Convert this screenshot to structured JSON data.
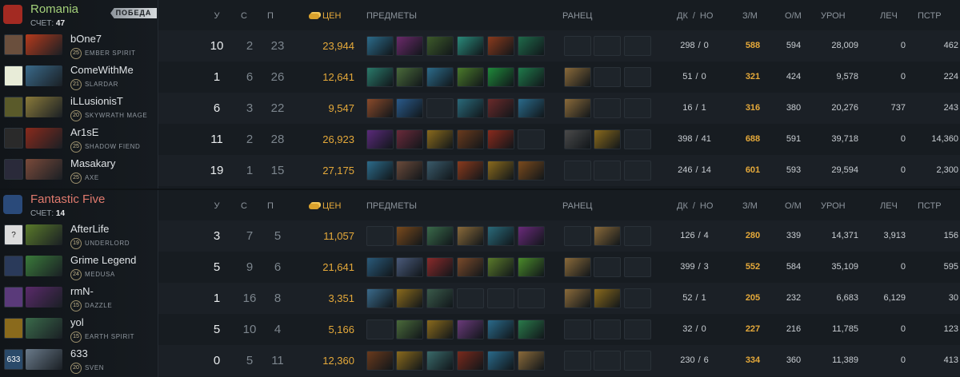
{
  "headers": {
    "kills": "У",
    "deaths": "С",
    "assists": "П",
    "networth": "ЦЕН",
    "items": "ПРЕДМЕТЫ",
    "backpack": "РАНЕЦ",
    "lasthits": "ДК",
    "slash": "/",
    "denies": "НО",
    "gpm": "З/М",
    "xpm": "О/М",
    "damage": "УРОН",
    "heal": "ЛЕЧ",
    "building": "ПСТР"
  },
  "teams": [
    {
      "name": "Romania",
      "name_color": "#a4d17a",
      "score_label": "СЧЕТ:",
      "score": "47",
      "badge": "ПОБЕДА",
      "logo_color": "#a32a22",
      "players": [
        {
          "name": "bOne7",
          "level": "25",
          "hero": "EMBER SPIRIT",
          "avatar_color": "#6a4f3d",
          "avatar_text": "",
          "hero_color": "#b53a1c",
          "kills": "10",
          "deaths": "2",
          "assists": "23",
          "networth": "23,944",
          "items": [
            "#2c6b8a",
            "#6b2a6a",
            "#3d5a2a",
            "#2a8a7a",
            "#8a3a1c",
            "#1f6a4a"
          ],
          "backpack": [
            "",
            "",
            ""
          ],
          "lh": "298",
          "dn": "0",
          "gpm": "588",
          "xpm": "594",
          "damage": "28,009",
          "heal": "0",
          "building": "462"
        },
        {
          "name": "ComeWithMe",
          "level": "21",
          "hero": "SLARDAR",
          "avatar_color": "#e8ecd8",
          "avatar_text": "",
          "hero_color": "#3a6a8a",
          "kills": "1",
          "deaths": "6",
          "assists": "26",
          "networth": "12,641",
          "items": [
            "#2a7a6a",
            "#4a6a3a",
            "#2c6b8a",
            "#4a7a2a",
            "#1f8a3a",
            "#1f7a4a"
          ],
          "backpack": [
            "#8a6a3a",
            "",
            ""
          ],
          "lh": "51",
          "dn": "0",
          "gpm": "321",
          "xpm": "424",
          "damage": "9,578",
          "heal": "0",
          "building": "224"
        },
        {
          "name": "iLLusionisT",
          "level": "20",
          "hero": "SKYWRATH MAGE",
          "avatar_color": "#5a5a2a",
          "avatar_text": "",
          "hero_color": "#8a7a3a",
          "kills": "6",
          "deaths": "3",
          "assists": "22",
          "networth": "9,547",
          "items": [
            "#8a4a2a",
            "#2a5a8a",
            "",
            "#2a6a7a",
            "#6a2a2a",
            "#2a6a8a"
          ],
          "backpack": [
            "#8a6a3a",
            "",
            ""
          ],
          "lh": "16",
          "dn": "1",
          "gpm": "316",
          "xpm": "380",
          "damage": "20,276",
          "heal": "737",
          "building": "243"
        },
        {
          "name": "Ar1sE",
          "level": "25",
          "hero": "SHADOW FIEND",
          "avatar_color": "#2a2a2a",
          "avatar_text": "",
          "hero_color": "#8a2a1c",
          "kills": "11",
          "deaths": "2",
          "assists": "28",
          "networth": "26,923",
          "items": [
            "#5a2a7a",
            "#6a2a3a",
            "#8a6a1c",
            "#6a3a1c",
            "#8a2a1c",
            ""
          ],
          "backpack": [
            "#4a4a4a",
            "#8a6a1c",
            ""
          ],
          "lh": "398",
          "dn": "41",
          "gpm": "688",
          "xpm": "591",
          "damage": "39,718",
          "heal": "0",
          "building": "14,360"
        },
        {
          "name": "Masakary",
          "level": "25",
          "hero": "AXE",
          "avatar_color": "#2a2a3a",
          "avatar_text": "",
          "hero_color": "#7a4a3a",
          "kills": "19",
          "deaths": "1",
          "assists": "15",
          "networth": "27,175",
          "items": [
            "#2c6b8a",
            "#6a4a3a",
            "#3a5a6a",
            "#8a3a1c",
            "#8a6a1c",
            "#7a4a1c"
          ],
          "backpack": [
            "",
            "",
            ""
          ],
          "lh": "246",
          "dn": "14",
          "gpm": "601",
          "xpm": "593",
          "damage": "29,594",
          "heal": "0",
          "building": "2,300"
        }
      ]
    },
    {
      "name": "Fantastic Five",
      "name_color": "#e07a6e",
      "score_label": "СЧЕТ:",
      "score": "14",
      "badge": "",
      "logo_color": "#2a4a7a",
      "players": [
        {
          "name": "AfterLife",
          "level": "19",
          "hero": "UNDERLORD",
          "avatar_color": "#dcdcdc",
          "avatar_text": "?",
          "hero_color": "#5a7a2a",
          "kills": "3",
          "deaths": "7",
          "assists": "5",
          "networth": "11,057",
          "items": [
            "",
            "#7a4a1c",
            "#3a6a4a",
            "#8a6a3a",
            "#2a6a7a",
            "#6a2a7a"
          ],
          "backpack": [
            "",
            "#8a6a3a",
            ""
          ],
          "lh": "126",
          "dn": "4",
          "gpm": "280",
          "xpm": "339",
          "damage": "14,371",
          "heal": "3,913",
          "building": "156"
        },
        {
          "name": "Grime Legend",
          "level": "24",
          "hero": "MEDUSA",
          "avatar_color": "#2a3a5a",
          "avatar_text": "",
          "hero_color": "#3a7a3a",
          "kills": "5",
          "deaths": "9",
          "assists": "6",
          "networth": "21,641",
          "items": [
            "#2a5a7a",
            "#4a5a7a",
            "#8a2a2a",
            "#7a4a2a",
            "#5a7a2a",
            "#4a8a2a"
          ],
          "backpack": [
            "#8a6a3a",
            "",
            ""
          ],
          "lh": "399",
          "dn": "3",
          "gpm": "552",
          "xpm": "584",
          "damage": "35,109",
          "heal": "0",
          "building": "595"
        },
        {
          "name": "rmN-",
          "level": "15",
          "hero": "DAZZLE",
          "avatar_color": "#5a3a7a",
          "avatar_text": "",
          "hero_color": "#5a2a6a",
          "kills": "1",
          "deaths": "16",
          "assists": "8",
          "networth": "3,351",
          "items": [
            "#3a6a8a",
            "#8a6a1c",
            "#3a5a4a",
            "",
            "",
            ""
          ],
          "backpack": [
            "#8a6a3a",
            "#8a6a1c",
            ""
          ],
          "lh": "52",
          "dn": "1",
          "gpm": "205",
          "xpm": "232",
          "damage": "6,683",
          "heal": "6,129",
          "building": "30"
        },
        {
          "name": "yol",
          "level": "15",
          "hero": "EARTH SPIRIT",
          "avatar_color": "#8a6a1c",
          "avatar_text": "",
          "hero_color": "#3a6a4a",
          "kills": "5",
          "deaths": "10",
          "assists": "4",
          "networth": "5,166",
          "items": [
            "",
            "#4a6a3a",
            "#8a6a1c",
            "#6a3a7a",
            "#2a6a8a",
            "#2a7a4a"
          ],
          "backpack": [
            "",
            "",
            ""
          ],
          "lh": "32",
          "dn": "0",
          "gpm": "227",
          "xpm": "216",
          "damage": "11,785",
          "heal": "0",
          "building": "123"
        },
        {
          "name": "633",
          "level": "20",
          "hero": "SVEN",
          "avatar_color": "#2a4a6a",
          "avatar_text": "633",
          "hero_color": "#6a7a8a",
          "kills": "0",
          "deaths": "5",
          "assists": "11",
          "networth": "12,360",
          "items": [
            "#6a3a1c",
            "#8a6a1c",
            "#3a6a6a",
            "#7a2a1c",
            "#2a6a8a",
            "#8a6a3a"
          ],
          "backpack": [
            "",
            "",
            ""
          ],
          "lh": "230",
          "dn": "6",
          "gpm": "334",
          "xpm": "360",
          "damage": "11,389",
          "heal": "0",
          "building": "413"
        }
      ]
    }
  ]
}
